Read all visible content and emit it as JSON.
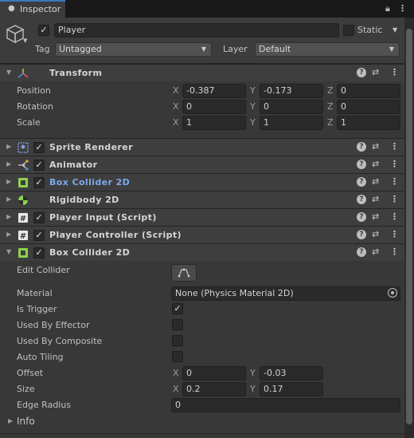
{
  "tab": {
    "label": "Inspector",
    "icon": "info-icon"
  },
  "header": {
    "object_name": "Player",
    "active": true,
    "static_label": "Static",
    "static_checked": false,
    "tag_label": "Tag",
    "tag_value": "Untagged",
    "layer_label": "Layer",
    "layer_value": "Default"
  },
  "transform": {
    "title": "Transform",
    "rows": [
      {
        "label": "Position",
        "x": "-0.387",
        "y": "-0.173",
        "z": "0"
      },
      {
        "label": "Rotation",
        "x": "0",
        "y": "0",
        "z": "0"
      },
      {
        "label": "Scale",
        "x": "1",
        "y": "1",
        "z": "1"
      }
    ],
    "axes": {
      "x": "X",
      "y": "Y",
      "z": "Z"
    }
  },
  "components": [
    {
      "title": "Sprite Renderer",
      "icon": "sprite-renderer-icon",
      "enabled": true,
      "selected": false
    },
    {
      "title": "Animator",
      "icon": "animator-icon",
      "enabled": true,
      "selected": false
    },
    {
      "title": "Box Collider 2D",
      "icon": "box-collider-icon",
      "enabled": true,
      "selected": true
    },
    {
      "title": "Rigidbody 2D",
      "icon": "rigidbody-icon",
      "enabled": null,
      "selected": false
    },
    {
      "title": "Player Input (Script)",
      "icon": "script-icon",
      "enabled": true,
      "selected": false
    },
    {
      "title": "Player Controller (Script)",
      "icon": "script-icon",
      "enabled": true,
      "selected": false
    }
  ],
  "box_collider": {
    "title": "Box Collider 2D",
    "edit_collider_label": "Edit Collider",
    "material_label": "Material",
    "material_value": "None (Physics Material 2D)",
    "is_trigger_label": "Is Trigger",
    "is_trigger": true,
    "used_by_effector_label": "Used By Effector",
    "used_by_effector": false,
    "used_by_composite_label": "Used By Composite",
    "used_by_composite": false,
    "auto_tiling_label": "Auto Tiling",
    "auto_tiling": false,
    "offset_label": "Offset",
    "offset_x": "0",
    "offset_y": "-0.03",
    "size_label": "Size",
    "size_x": "0.2",
    "size_y": "0.17",
    "edge_radius_label": "Edge Radius",
    "edge_radius": "0",
    "info_label": "Info"
  },
  "glyphs": {
    "check": "✓",
    "help": "?",
    "fold_open": "▼",
    "fold_closed": "▶",
    "arrow": "▼",
    "kebab": "⋮",
    "preset": "⇄"
  },
  "colors": {
    "accent_tab": "#3a79bb",
    "selected_title": "#7aa9ec",
    "background": "#383838"
  }
}
